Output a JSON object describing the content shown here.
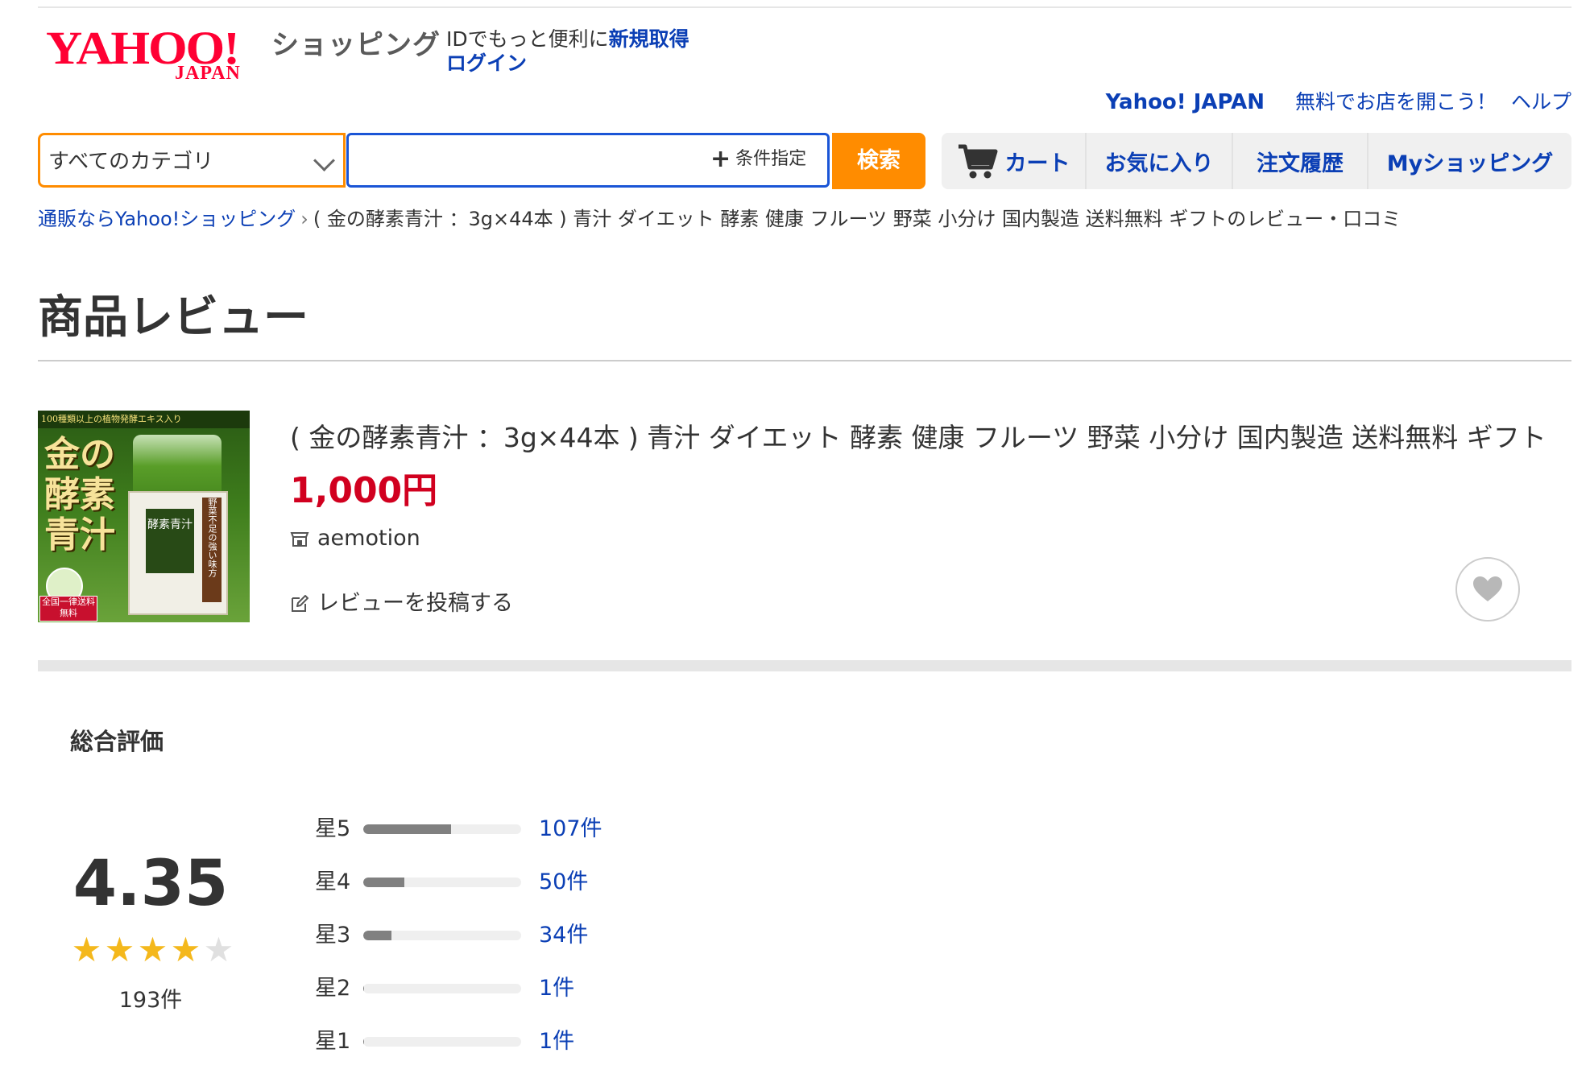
{
  "header": {
    "logo_yahoo": "YAHOO!",
    "logo_japan": "JAPAN",
    "shopping": "ショッピング",
    "id_prefix": "IDでもっと便利に",
    "id_link": "新規取得",
    "login": "ログイン",
    "top_links": {
      "yahoo_japan": "Yahoo! JAPAN",
      "open_store": "無料でお店を開こう！",
      "help": "ヘルプ"
    }
  },
  "search": {
    "category": "すべてのカテゴリ",
    "query": "",
    "conditions": "条件指定",
    "button": "検索"
  },
  "nav": {
    "cart": "カート",
    "favorites": "お気に入り",
    "orders": "注文履歴",
    "my_shopping": "Myショッピング"
  },
  "breadcrumb": {
    "home": "通販ならYahoo!ショッピング",
    "separator": "›",
    "current": "( 金の酵素青汁 ：3g×44本 ) 青汁 ダイエット 酵素 健康 フルーツ 野菜 小分け 国内製造 送料無料 ギフトのレビュー・口コミ"
  },
  "page_title": "商品レビュー",
  "product": {
    "title": "( 金の酵素青汁 ：3g×44本 ) 青汁 ダイエット 酵素 健康 フルーツ 野菜 小分け 国内製造 送料無料 ギフト",
    "price": "1,000円",
    "store": "aemotion",
    "write_review": "レビューを投稿する",
    "image": {
      "band": "100種類以上の植物発酵エキス入り",
      "big_text": "金の酵素青汁",
      "label": "酵素青汁",
      "vertical": "野菜不足の強い味方",
      "ship": "全国一律送料無料"
    }
  },
  "rating": {
    "title": "総合評価",
    "score": "4.35",
    "score_value": 4.35,
    "total": "193件",
    "distribution": [
      {
        "label": "星5",
        "count": "107件",
        "value": 107
      },
      {
        "label": "星4",
        "count": "50件",
        "value": 50
      },
      {
        "label": "星3",
        "count": "34件",
        "value": 34
      },
      {
        "label": "星2",
        "count": "1件",
        "value": 1
      },
      {
        "label": "星1",
        "count": "1件",
        "value": 1
      }
    ],
    "star_color": "#f4b81c",
    "bar_color": "#808080"
  },
  "colors": {
    "brand_red": "#ff0033",
    "link_blue": "#0b3fb5",
    "accent_orange": "#ff8c00",
    "price_red": "#d1001f"
  }
}
